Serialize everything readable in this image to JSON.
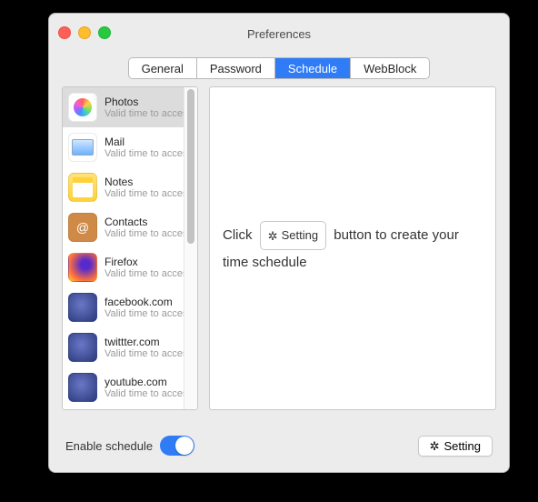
{
  "window": {
    "title": "Preferences"
  },
  "tabs": [
    {
      "label": "General",
      "active": false
    },
    {
      "label": "Password",
      "active": false
    },
    {
      "label": "Schedule",
      "active": true
    },
    {
      "label": "WebBlock",
      "active": false
    }
  ],
  "sidebar": {
    "sub": "Valid time to access",
    "items": [
      {
        "name": "Photos",
        "icon": "photos",
        "selected": true
      },
      {
        "name": "Mail",
        "icon": "mail"
      },
      {
        "name": "Notes",
        "icon": "notes"
      },
      {
        "name": "Contacts",
        "icon": "contacts"
      },
      {
        "name": "Firefox",
        "icon": "firefox"
      },
      {
        "name": "facebook.com",
        "icon": "web"
      },
      {
        "name": "twittter.com",
        "icon": "web"
      },
      {
        "name": "youtube.com",
        "icon": "web"
      }
    ]
  },
  "main": {
    "hint_pre": "Click",
    "hint_button": "Setting",
    "hint_post": "button to create your time schedule"
  },
  "bottom": {
    "enable_label": "Enable schedule",
    "enable_on": true,
    "setting_label": "Setting"
  }
}
